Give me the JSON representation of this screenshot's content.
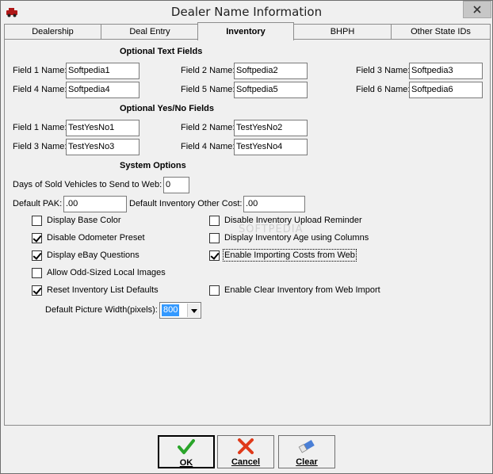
{
  "window": {
    "title": "Dealer Name Information"
  },
  "tabs": [
    {
      "label": "Dealership"
    },
    {
      "label": "Deal Entry"
    },
    {
      "label": "Inventory"
    },
    {
      "label": "BHPH"
    },
    {
      "label": "Other State IDs"
    }
  ],
  "text_fields": {
    "heading": "Optional Text Fields",
    "fields": [
      {
        "label": "Field 1 Name:",
        "value": "Softpedia1"
      },
      {
        "label": "Field 2 Name:",
        "value": "Softpedia2"
      },
      {
        "label": "Field 3 Name:",
        "value": "Softpedia3"
      },
      {
        "label": "Field 4 Name:",
        "value": "Softpedia4"
      },
      {
        "label": "Field 5 Name:",
        "value": "Softpedia5"
      },
      {
        "label": "Field 6 Name:",
        "value": "Softpedia6"
      }
    ]
  },
  "yesno_fields": {
    "heading": "Optional Yes/No Fields",
    "fields": [
      {
        "label": "Field 1 Name:",
        "value": "TestYesNo1"
      },
      {
        "label": "Field 2 Name:",
        "value": "TestYesNo2"
      },
      {
        "label": "Field 3 Name:",
        "value": "TestYesNo3"
      },
      {
        "label": "Field 4 Name:",
        "value": "TestYesNo4"
      }
    ]
  },
  "system": {
    "heading": "System Options",
    "days_label": "Days of Sold Vehicles to Send to Web:",
    "days_value": "0",
    "pak_label": "Default PAK:",
    "pak_value": ".00",
    "other_cost_label": "Default Inventory Other Cost:",
    "other_cost_value": ".00",
    "checkboxes": [
      {
        "label": "Display Base Color",
        "checked": false
      },
      {
        "label": "Disable Inventory Upload Reminder",
        "checked": false
      },
      {
        "label": "Disable Odometer Preset",
        "checked": true
      },
      {
        "label": "Display Inventory Age using Columns",
        "checked": false
      },
      {
        "label": "Display eBay Questions",
        "checked": true
      },
      {
        "label": "Enable Importing Costs from Web",
        "checked": true
      },
      {
        "label": "Allow Odd-Sized Local Images",
        "checked": false
      },
      {
        "label": "Reset Inventory List Defaults",
        "checked": true
      },
      {
        "label": "Enable Clear Inventory from Web Import",
        "checked": false
      }
    ],
    "picture_width_label": "Default Picture Width(pixels):",
    "picture_width_value": "800"
  },
  "buttons": {
    "ok": "OK",
    "cancel": "Cancel",
    "clear": "Clear"
  },
  "watermark": "SOFTPEDIA",
  "colors": {
    "selection": "#3399ff",
    "ok_green": "#2aa52a",
    "cancel_red": "#e03a1a"
  }
}
